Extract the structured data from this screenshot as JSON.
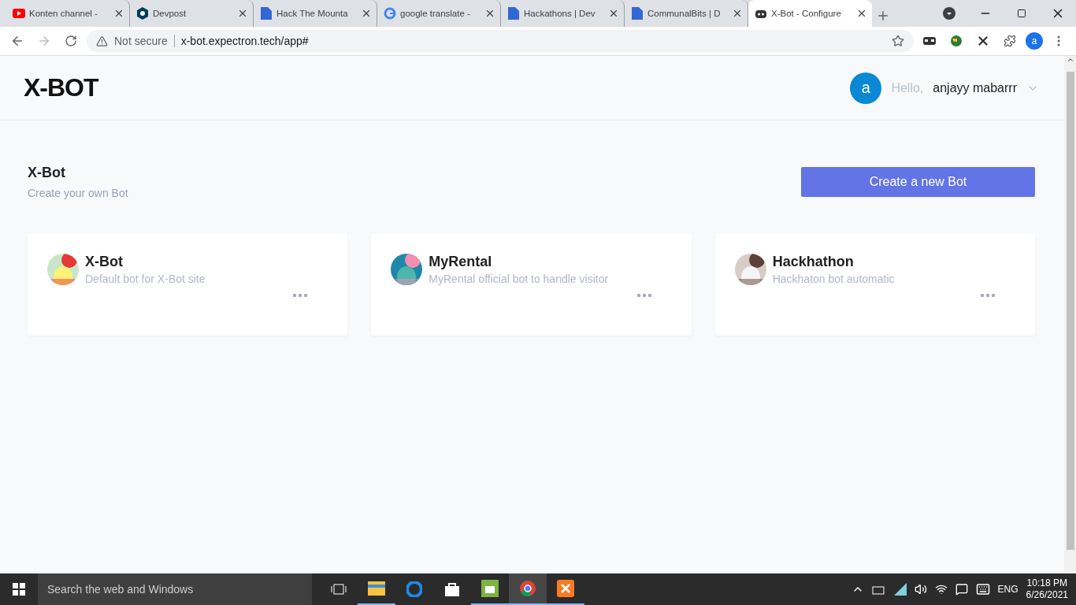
{
  "browser": {
    "tabs": [
      {
        "title": "Konten channel -",
        "selected": false
      },
      {
        "title": "Devpost",
        "selected": false
      },
      {
        "title": "Hack The Mounta",
        "selected": false
      },
      {
        "title": "google translate -",
        "selected": false
      },
      {
        "title": "Hackathons | Dev",
        "selected": false
      },
      {
        "title": "CommunalBits | D",
        "selected": false
      },
      {
        "title": "X-Bot - Configure",
        "selected": true
      }
    ],
    "security": "Not secure",
    "url": "x-bot.expectron.tech/app#",
    "profile_initial": "a"
  },
  "header": {
    "logo": "X-BOT",
    "user": {
      "initial": "a",
      "greeting": "Hello,",
      "name": "anjayy mabarrr"
    }
  },
  "section": {
    "title": "X-Bot",
    "subtitle": "Create your own Bot",
    "create_button": "Create a new Bot"
  },
  "bots": [
    {
      "name": "X-Bot",
      "description": "Default bot for X-Bot site"
    },
    {
      "name": "MyRental",
      "description": "MyRental official bot to handle visitor"
    },
    {
      "name": "Hackhathon",
      "description": "Hackhaton bot automatic"
    }
  ],
  "taskbar": {
    "search": "Search the web and Windows",
    "language": "ENG",
    "time": "10:18 PM",
    "date": "6/26/2021"
  }
}
